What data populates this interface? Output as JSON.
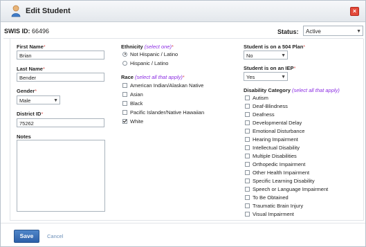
{
  "dialog": {
    "title": "Edit Student",
    "close_symbol": "×"
  },
  "swis": {
    "label": "SWIS ID:",
    "value": "66496"
  },
  "status": {
    "label": "Status:",
    "value": "Active"
  },
  "col1": {
    "first_name": {
      "label": "First Name",
      "value": "Brian"
    },
    "last_name": {
      "label": "Last Name",
      "value": "Bender"
    },
    "gender": {
      "label": "Gender",
      "value": "Male"
    },
    "district_id": {
      "label": "District ID",
      "value": "75262"
    },
    "notes": {
      "label": "Notes",
      "value": ""
    }
  },
  "col2": {
    "ethnicity": {
      "label": "Ethnicity",
      "hint": "(select one)",
      "options": [
        "Not Hispanic / Latino",
        "Hispanic / Latino"
      ],
      "selected": "Not Hispanic / Latino"
    },
    "race": {
      "label": "Race",
      "hint": "(select all that apply)",
      "options": [
        "American Indian/Alaskan Native",
        "Asian",
        "Black",
        "Pacific Islander/Native Hawaiian",
        "White"
      ],
      "checked": [
        "White"
      ]
    }
  },
  "col3": {
    "plan504": {
      "label": "Student is on a 504 Plan",
      "value": "No"
    },
    "iep": {
      "label": "Student is on an IEP",
      "value": "Yes"
    },
    "disability": {
      "label": "Disability Category",
      "hint": "(select all that apply)",
      "options": [
        "Autism",
        "Deaf-Blindness",
        "Deafness",
        "Developmental Delay",
        "Emotional Disturbance",
        "Hearing Impairment",
        "Intellectual Disability",
        "Multiple Disabilities",
        "Orthopedic Impairment",
        "Other Health Impairment",
        "Specific Learning Disability",
        "Speech or Language Impairment",
        "To Be Obtained",
        "Traumatic Brain Injury",
        "Visual Impairment"
      ]
    }
  },
  "footer": {
    "save": "Save",
    "cancel": "Cancel"
  },
  "required_marker": "*",
  "colors": {
    "accent": "#2c5fa8",
    "required": "#d9534f",
    "close": "#e34a3a"
  },
  "icons": {
    "title": "student-icon",
    "close": "close-icon",
    "dropdown": "chevron-down-icon"
  }
}
